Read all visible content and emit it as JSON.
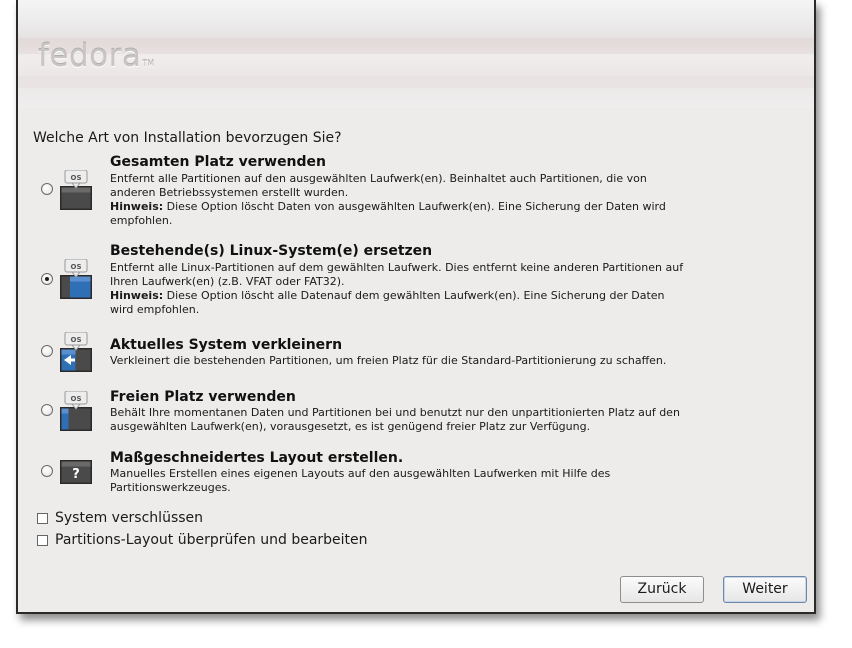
{
  "branding": {
    "logo_text": "fedora",
    "logo_tm": "TM"
  },
  "question": "Welche Art von Installation bevorzugen Sie?",
  "options": [
    {
      "title": "Gesamten Platz verwenden",
      "line1": "Entfernt alle Partitionen auf den ausgewählten Laufwerk(en). Beinhaltet auch Partitionen, die von",
      "line2": "anderen Betriebssystemen erstellt wurden.",
      "hint_label": "Hinweis:",
      "hint_line1": " Diese Option löscht Daten von ausgewählten Laufwerk(en). Eine Sicherung der Daten wird",
      "hint_line2": "empfohlen.",
      "selected": false,
      "icon": "os-disk-all-icon",
      "icon_label": "OS"
    },
    {
      "title": "Bestehende(s) Linux-System(e) ersetzen",
      "line1": "Entfernt alle Linux-Partitionen auf dem gewählten Laufwerk. Dies entfernt keine anderen Partitionen auf",
      "line2": "Ihren Laufwerk(en) (z.B. VFAT oder FAT32).",
      "hint_label": "Hinweis:",
      "hint_line1": " Diese Option löscht alle Datenauf dem gewählten Laufwerk(en). Eine Sicherung der Daten",
      "hint_line2": "wird empfohlen.",
      "selected": true,
      "icon": "os-disk-replace-linux-icon",
      "icon_label": "OS"
    },
    {
      "title": "Aktuelles System verkleinern",
      "line1": "Verkleinert die bestehenden Partitionen, um freien Platz für die Standard-Partitionierung zu schaffen.",
      "selected": false,
      "icon": "os-disk-shrink-icon",
      "icon_label": "OS"
    },
    {
      "title": "Freien Platz verwenden",
      "line1": "Behält Ihre momentanen Daten und Partitionen bei und benutzt nur den unpartitionierten Platz auf den",
      "line2": "ausgewählten Laufwerk(en), vorausgesetzt, es ist genügend freier Platz zur Verfügung.",
      "selected": false,
      "icon": "os-disk-free-space-icon",
      "icon_label": "OS"
    },
    {
      "title": "Maßgeschneidertes Layout erstellen.",
      "line1": "Manuelles Erstellen eines eigenen Layouts auf den ausgewählten Laufwerken mit Hilfe des",
      "line2": "Partitionswerkzeuges.",
      "selected": false,
      "icon": "custom-layout-question-icon",
      "icon_label": "?"
    }
  ],
  "checkboxes": [
    {
      "label": "System verschlüssen",
      "checked": false
    },
    {
      "label": "Partitions-Layout überprüfen und bearbeiten",
      "checked": false
    }
  ],
  "buttons": {
    "back": "Zurück",
    "next": "Weiter"
  },
  "colors": {
    "window_bg": "#edeceb",
    "accent_blue": "#2f6fb5",
    "icon_dark": "#3f3f3f"
  }
}
